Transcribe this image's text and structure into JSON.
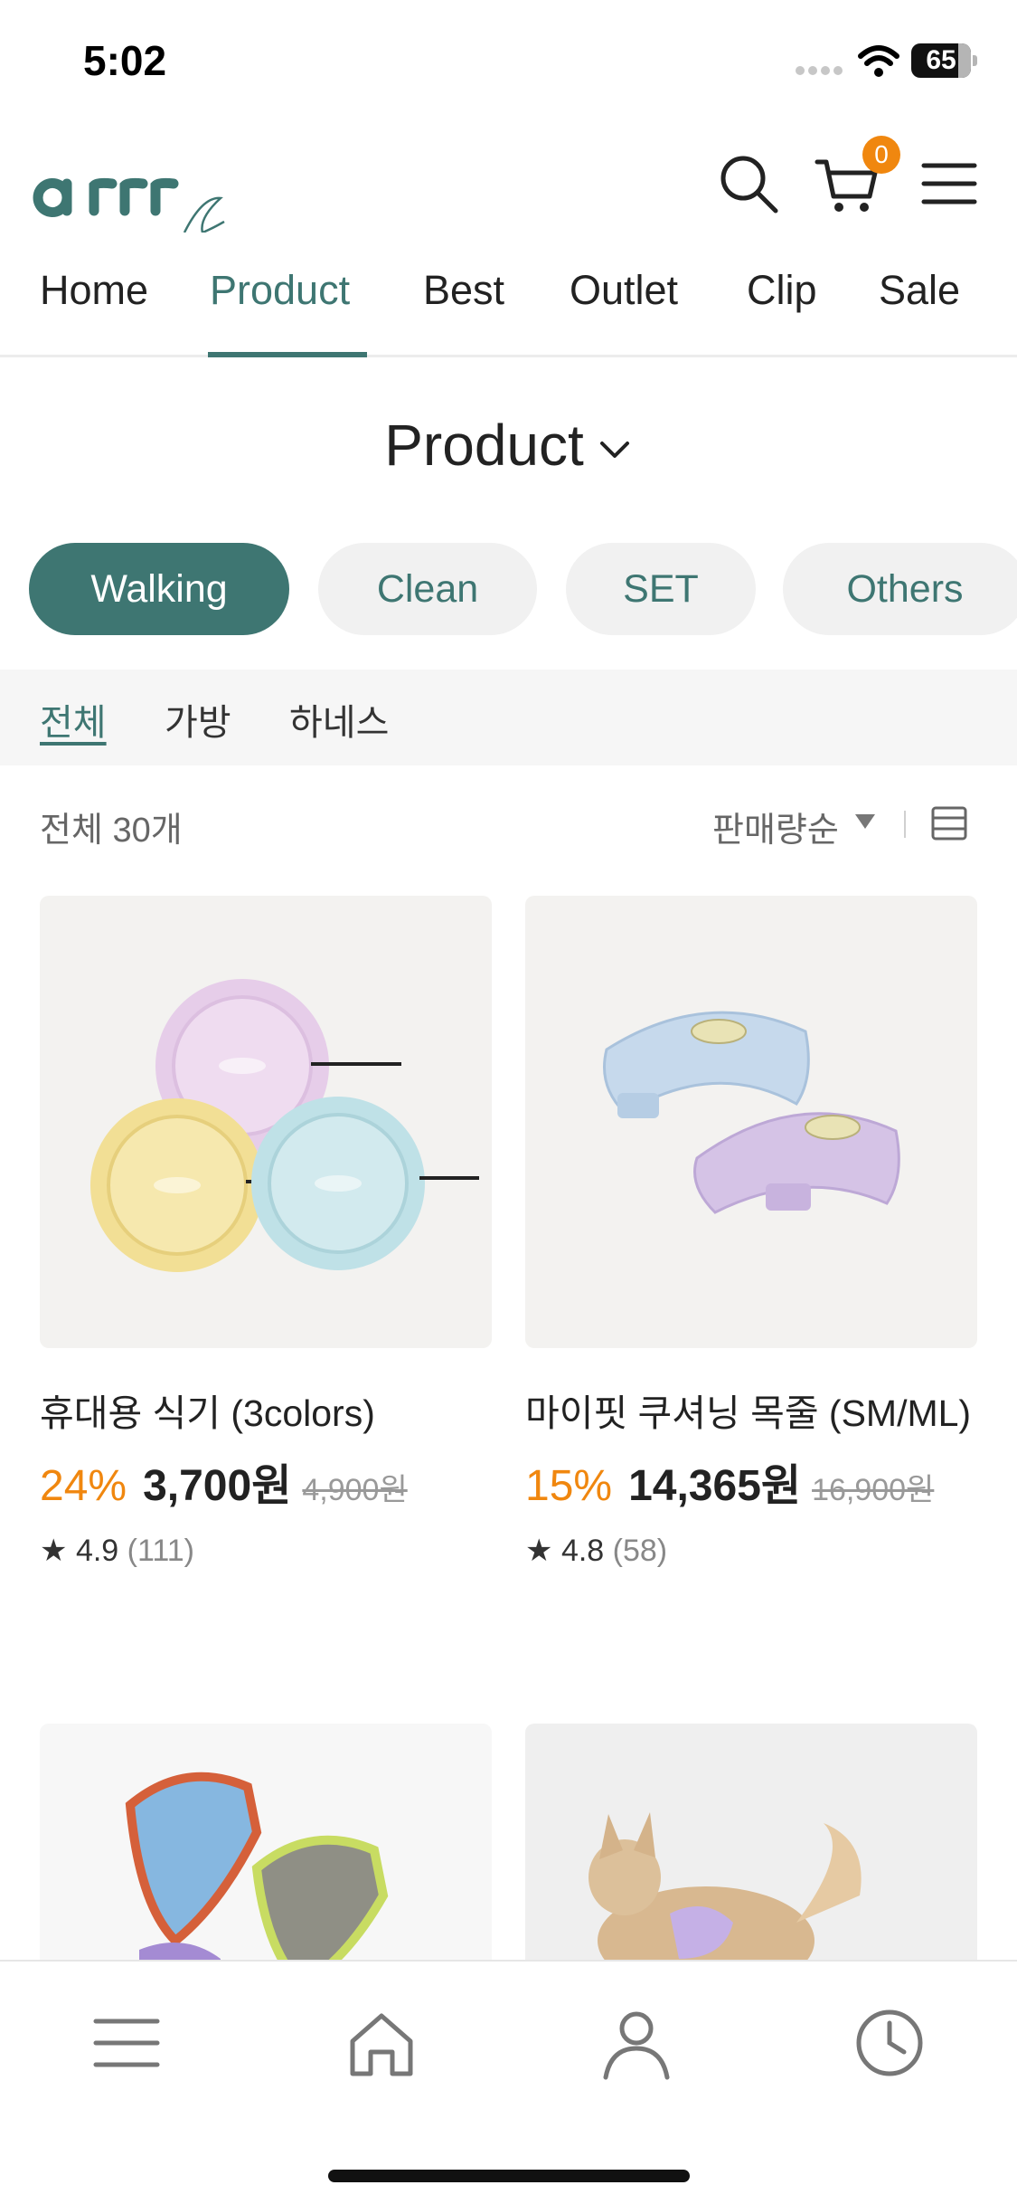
{
  "status_bar": {
    "time": "5:02",
    "battery": "65"
  },
  "brand": {
    "logo_text": "arrr",
    "accent": "#3e7672",
    "badge_color": "#f0870f"
  },
  "header": {
    "cart_count": "0"
  },
  "nav": {
    "tabs": [
      {
        "label": "Home"
      },
      {
        "label": "Product"
      },
      {
        "label": "Best"
      },
      {
        "label": "Outlet"
      },
      {
        "label": "Clip"
      },
      {
        "label": "Sale"
      }
    ],
    "active": "Product"
  },
  "page": {
    "title": "Product"
  },
  "categories": [
    {
      "label": "Walking"
    },
    {
      "label": "Clean"
    },
    {
      "label": "SET"
    },
    {
      "label": "Others"
    }
  ],
  "subfilters": [
    {
      "label": "전체"
    },
    {
      "label": "가방"
    },
    {
      "label": "하네스"
    }
  ],
  "listing": {
    "count_label": "전체 30개",
    "sort_label": "판매량순"
  },
  "products": [
    {
      "name": "휴대용 식기 (3colors)",
      "discount": "24%",
      "price": "3,700원",
      "original_price": "4,900원",
      "rating": "4.9",
      "reviews": "(111)"
    },
    {
      "name": "마이핏 쿠셔닝 목줄 (SM/ML)",
      "discount": "15%",
      "price": "14,365원",
      "original_price": "16,900원",
      "rating": "4.8",
      "reviews": "(58)"
    }
  ],
  "tabbar": {
    "icons": [
      "menu-icon",
      "home-icon",
      "user-icon",
      "clock-icon"
    ]
  }
}
